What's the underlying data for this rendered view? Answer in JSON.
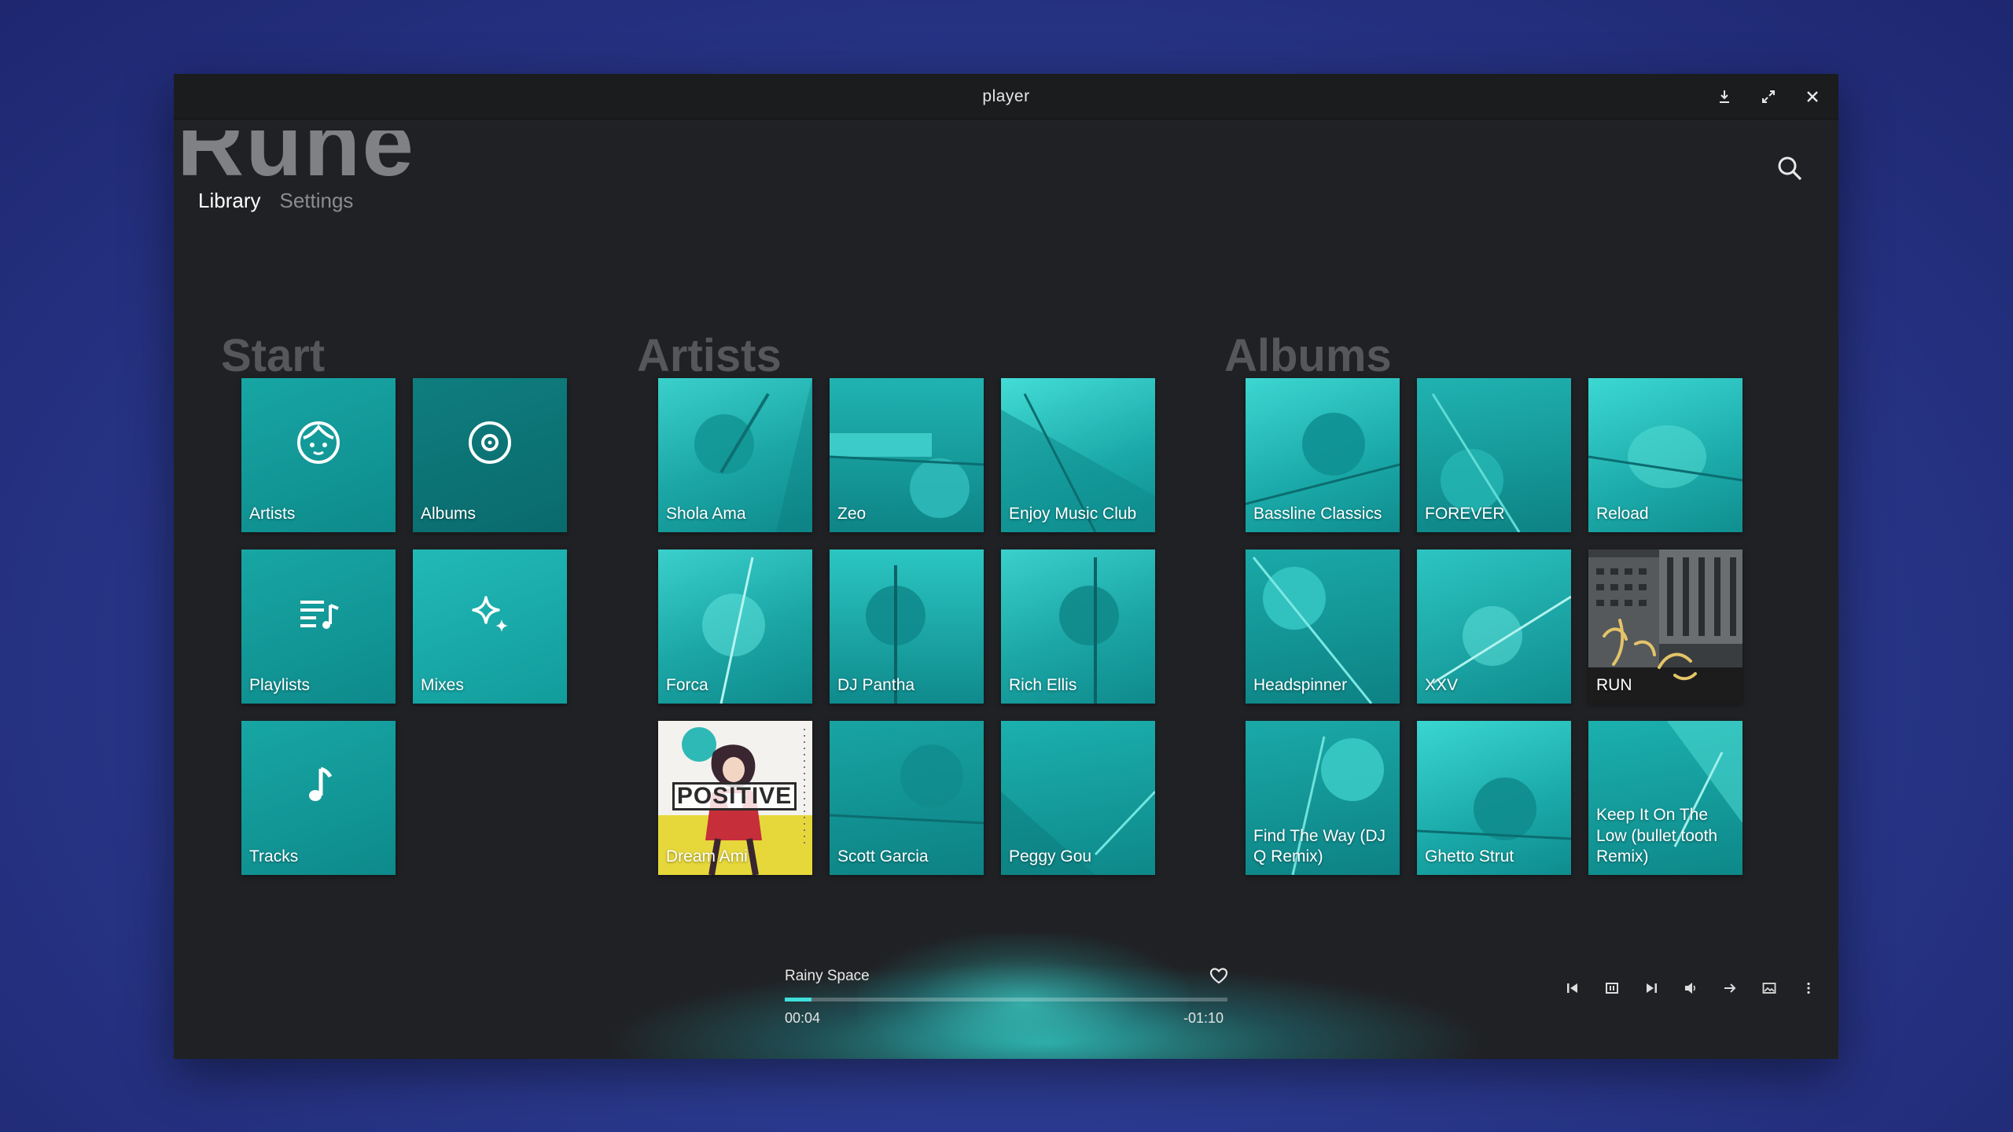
{
  "window": {
    "title": "player"
  },
  "app": {
    "logo": "Rune"
  },
  "nav": {
    "tabs": [
      {
        "label": "Library",
        "active": true
      },
      {
        "label": "Settings",
        "active": false
      }
    ]
  },
  "sections": {
    "start": {
      "title": "Start",
      "tiles": [
        {
          "label": "Artists",
          "icon": "face-icon"
        },
        {
          "label": "Albums",
          "icon": "disc-icon"
        },
        {
          "label": "Playlists",
          "icon": "playlist-icon"
        },
        {
          "label": "Mixes",
          "icon": "sparkle-icon"
        },
        {
          "label": "Tracks",
          "icon": "music-note-icon"
        }
      ]
    },
    "artists": {
      "title": "Artists",
      "items": [
        {
          "label": "Shola Ama"
        },
        {
          "label": "Zeo"
        },
        {
          "label": "Enjoy Music Club"
        },
        {
          "label": "Forca"
        },
        {
          "label": "DJ Pantha"
        },
        {
          "label": "Rich Ellis"
        },
        {
          "label": "Dream Ami",
          "cover_text": "POSITIVE"
        },
        {
          "label": "Scott Garcia"
        },
        {
          "label": "Peggy Gou"
        }
      ]
    },
    "albums": {
      "title": "Albums",
      "items": [
        {
          "label": "Bassline Classics"
        },
        {
          "label": "FOREVER"
        },
        {
          "label": "Reload"
        },
        {
          "label": "Headspinner"
        },
        {
          "label": "XXV"
        },
        {
          "label": "RUN"
        },
        {
          "label": "Find The Way (DJ Q Remix)"
        },
        {
          "label": "Ghetto Strut"
        },
        {
          "label": "Keep It On The Low (bullet tooth Remix)"
        }
      ]
    }
  },
  "player": {
    "track_title": "Rainy Space",
    "elapsed": "00:04",
    "remaining": "-01:10",
    "progress": 0.06,
    "accent_color": "#3fe0da"
  },
  "colors": {
    "tile_accent": "#1fb3b1",
    "background": "#202124"
  }
}
